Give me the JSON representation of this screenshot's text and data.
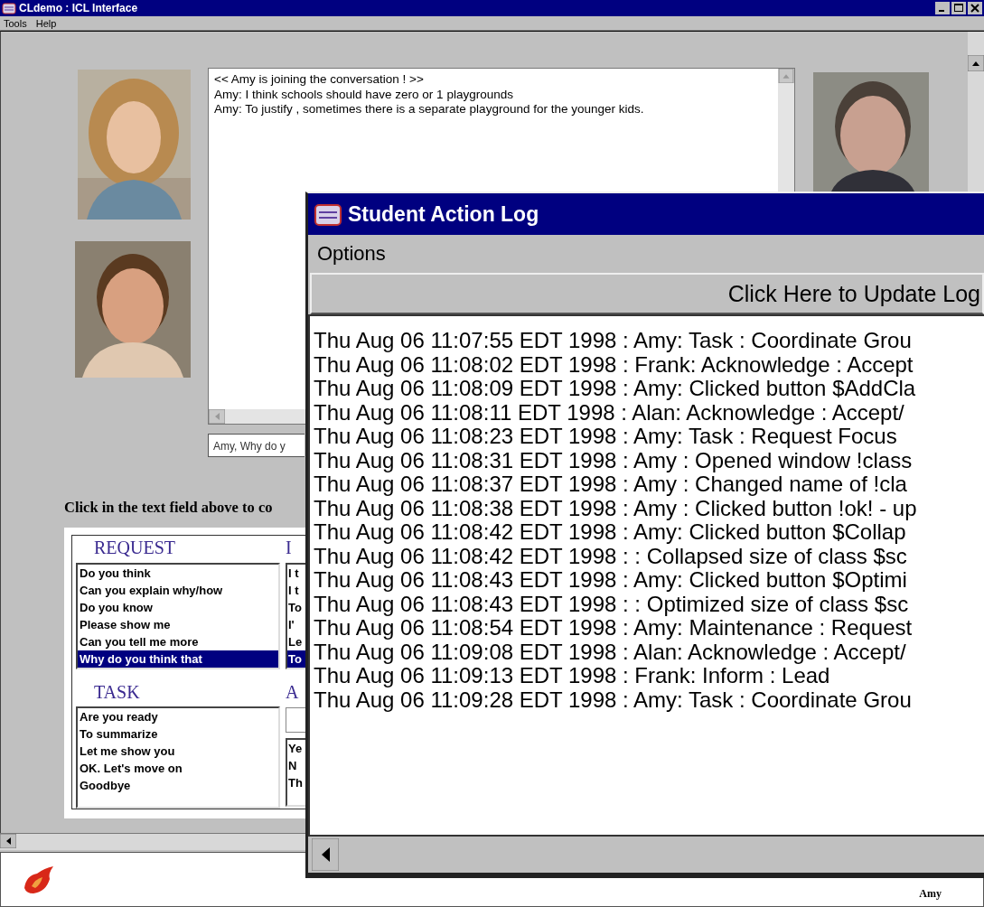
{
  "main_window": {
    "title": "CLdemo : ICL Interface",
    "menu": [
      "Tools",
      "Help"
    ]
  },
  "chat": {
    "lines": [
      "<< Amy is joining the conversation ! >>",
      "Amy: I think schools should have zero or 1 playgrounds",
      "Amy: To justify , sometimes there is a separate playground for the younger kids."
    ],
    "input_value": "Amy, Why do y"
  },
  "hint": "Click in the text field above to co",
  "panels": [
    {
      "heading": "REQUEST",
      "kind": "list",
      "items": [
        {
          "text": "Do you think",
          "selected": false
        },
        {
          "text": "Can you explain why/how",
          "selected": false
        },
        {
          "text": "Do you know",
          "selected": false
        },
        {
          "text": "Please show me",
          "selected": false
        },
        {
          "text": "Can you tell me more",
          "selected": false
        },
        {
          "text": "Why do you think that",
          "selected": true
        }
      ]
    },
    {
      "heading": "I",
      "kind": "list",
      "items": [
        {
          "text": "I t",
          "selected": false
        },
        {
          "text": "I t",
          "selected": false
        },
        {
          "text": "To",
          "selected": false
        },
        {
          "text": "I'",
          "selected": false
        },
        {
          "text": "Le",
          "selected": false
        },
        {
          "text": "To",
          "selected": true
        }
      ]
    },
    {
      "heading": "TASK",
      "kind": "list",
      "items": [
        {
          "text": "Are you ready",
          "selected": false
        },
        {
          "text": "To summarize",
          "selected": false
        },
        {
          "text": "Let me show you",
          "selected": false
        },
        {
          "text": "OK. Let's move on",
          "selected": false
        },
        {
          "text": "Goodbye",
          "selected": false
        }
      ]
    },
    {
      "heading": "A",
      "kind": "field_list",
      "items": [
        {
          "text": "Ye",
          "selected": false
        },
        {
          "text": "N",
          "selected": false
        },
        {
          "text": "Th",
          "selected": false
        }
      ]
    }
  ],
  "status_user": "Amy",
  "log_window": {
    "title": "Student Action Log",
    "menu": [
      "Options"
    ],
    "button": "Click Here to Update Log",
    "entries": [
      "Thu Aug 06 11:07:55 EDT 1998 : Amy: Task : Coordinate Grou",
      "Thu Aug 06 11:08:02 EDT 1998 : Frank: Acknowledge : Accept",
      "Thu Aug 06 11:08:09 EDT 1998 : Amy: Clicked button $AddCla",
      "Thu Aug 06 11:08:11 EDT 1998 : Alan: Acknowledge : Accept/",
      "Thu Aug 06 11:08:23 EDT 1998 : Amy: Task : Request Focus",
      "Thu Aug 06 11:08:31 EDT 1998 : Amy : Opened window !class",
      "Thu Aug 06 11:08:37 EDT 1998 : Amy : Changed name of !cla",
      "Thu Aug 06 11:08:38 EDT 1998 : Amy : Clicked button !ok! - up",
      "Thu Aug 06 11:08:42 EDT 1998 : Amy: Clicked button $Collap",
      "Thu Aug 06 11:08:42 EDT 1998 : : Collapsed size of class $sc",
      "Thu Aug 06 11:08:43 EDT 1998 : Amy: Clicked button $Optimi",
      "Thu Aug 06 11:08:43 EDT 1998 : : Optimized size of class $sc",
      "Thu Aug 06 11:08:54 EDT 1998 : Amy: Maintenance : Request",
      "Thu Aug 06 11:09:08 EDT 1998 : Alan: Acknowledge : Accept/",
      "Thu Aug 06 11:09:13 EDT 1998 : Frank: Inform : Lead",
      "Thu Aug 06 11:09:28 EDT 1998 : Amy: Task : Coordinate Grou"
    ]
  }
}
